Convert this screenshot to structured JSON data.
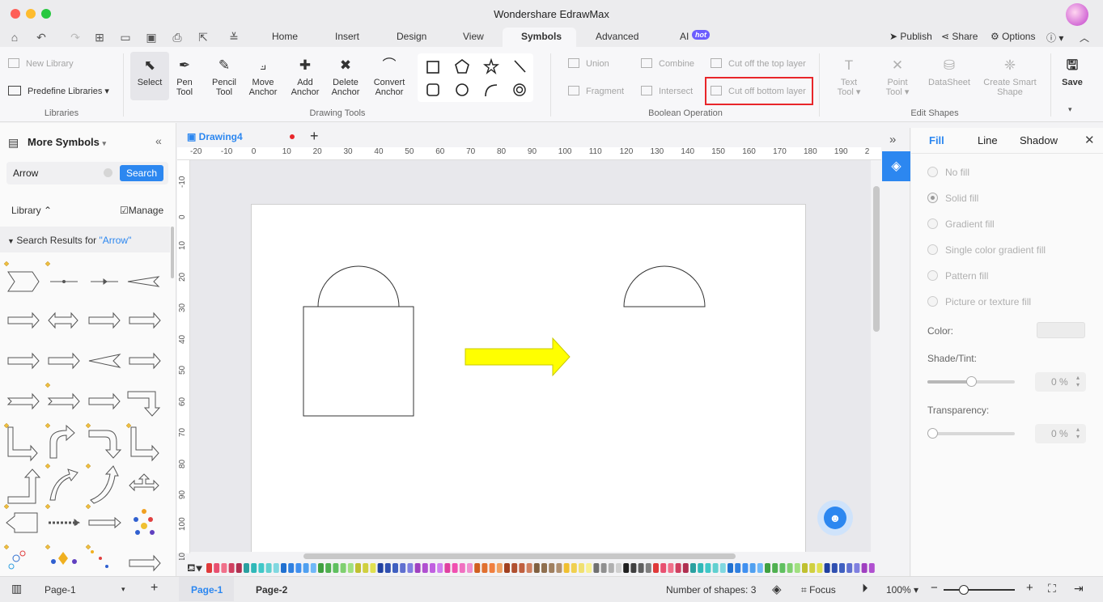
{
  "window": {
    "title": "Wondershare EdrawMax"
  },
  "menu": {
    "tabs": [
      "Home",
      "Insert",
      "Design",
      "View",
      "Symbols",
      "Advanced",
      "AI"
    ],
    "active_tab": "Symbols",
    "ai_badge": "hot",
    "publish": "Publish",
    "share": "Share",
    "options": "Options"
  },
  "ribbon": {
    "libraries": {
      "new_library": "New Library",
      "predefine": "Predefine Libraries",
      "group_label": "Libraries"
    },
    "drawing_tools": {
      "select": "Select",
      "pen": [
        "Pen",
        "Tool"
      ],
      "pencil": [
        "Pencil",
        "Tool"
      ],
      "move_anchor": [
        "Move",
        "Anchor"
      ],
      "add_anchor": [
        "Add",
        "Anchor"
      ],
      "delete_anchor": [
        "Delete",
        "Anchor"
      ],
      "convert_anchor": [
        "Convert",
        "Anchor"
      ],
      "group_label": "Drawing Tools"
    },
    "boolean": {
      "union": "Union",
      "combine": "Combine",
      "cut_top": "Cut off the top layer",
      "fragment": "Fragment",
      "intersect": "Intersect",
      "cut_bottom": "Cut off bottom layer",
      "group_label": "Boolean Operation"
    },
    "edit_shapes": {
      "text_tool": [
        "Text",
        "Tool"
      ],
      "point_tool": [
        "Point",
        "Tool"
      ],
      "datasheet": "DataSheet",
      "smart_shape": [
        "Create Smart",
        "Shape"
      ],
      "group_label": "Edit Shapes"
    },
    "save": "Save"
  },
  "left_panel": {
    "title": "More Symbols",
    "search_value": "Arrow",
    "search_button": "Search",
    "library_label": "Library",
    "manage": "Manage",
    "results_prefix": "Search Results for ",
    "results_term": "\"Arrow\""
  },
  "document": {
    "tab_name": "Drawing4"
  },
  "ruler": {
    "h_ticks": [
      "-20",
      "-10",
      "0",
      "10",
      "20",
      "30",
      "40",
      "50",
      "60",
      "70",
      "80",
      "90",
      "100",
      "110",
      "120",
      "130",
      "140",
      "150",
      "160",
      "170",
      "180",
      "190",
      "2"
    ],
    "v_ticks": [
      "-10",
      "0",
      "10",
      "20",
      "30",
      "40",
      "50",
      "60",
      "70",
      "80",
      "90",
      "100",
      "10"
    ]
  },
  "right_panel": {
    "tabs": [
      "Fill",
      "Line",
      "Shadow"
    ],
    "active_tab": "Fill",
    "fill_options": [
      "No fill",
      "Solid fill",
      "Gradient fill",
      "Single color gradient fill",
      "Pattern fill",
      "Picture or texture fill"
    ],
    "selected_fill": "Solid fill",
    "color_label": "Color:",
    "shade_label": "Shade/Tint:",
    "shade_value": "0 %",
    "transparency_label": "Transparency:",
    "transparency_value": "0 %"
  },
  "status": {
    "page_selector": "Page-1",
    "pages": [
      "Page-1",
      "Page-2"
    ],
    "active_page": "Page-1",
    "shape_count": "Number of shapes: 3",
    "focus": "Focus",
    "zoom": "100%"
  },
  "colors": {
    "accent": "#2c87f0",
    "arrow_fill": "#ffff00",
    "highlight_box": "#e8262a"
  }
}
